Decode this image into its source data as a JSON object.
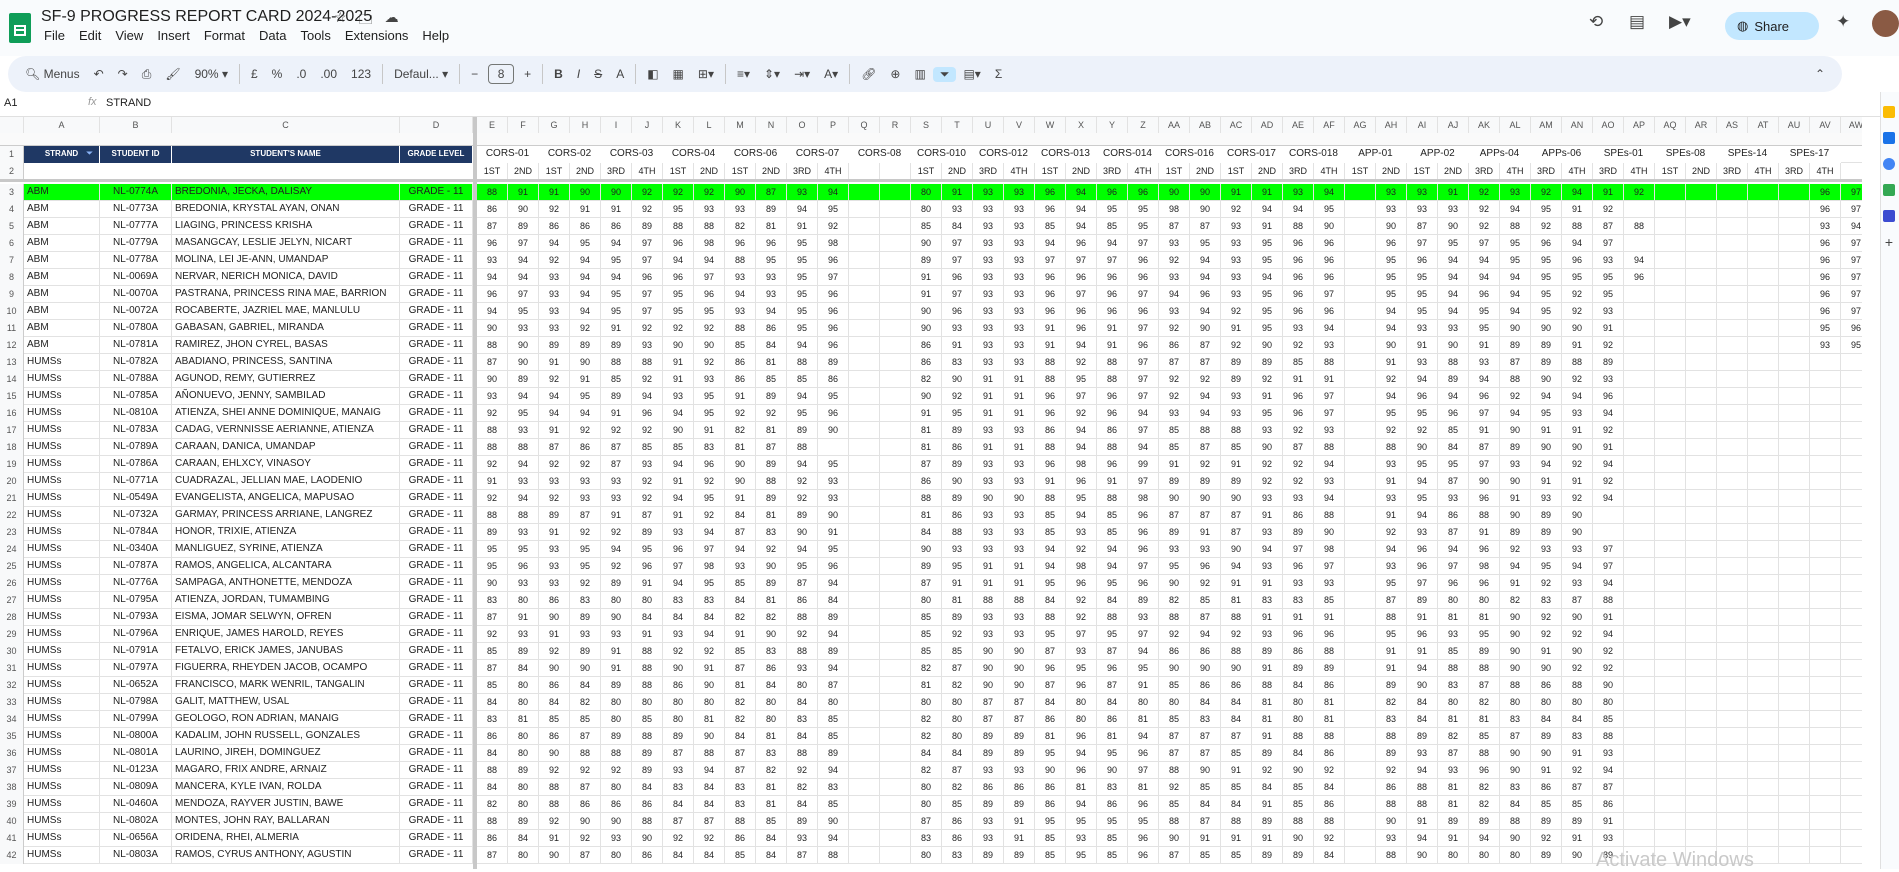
{
  "doc": {
    "title": "SF-9 PROGRESS REPORT CARD 2024-2025",
    "menus": [
      "File",
      "Edit",
      "View",
      "Insert",
      "Format",
      "Data",
      "Tools",
      "Extensions",
      "Help"
    ]
  },
  "toolbar": {
    "menus_label": "Menus",
    "zoom": "90%",
    "currency": "£",
    "percent": "%",
    "dec_less": ".0",
    "dec_more": ".00",
    "number_format": "123",
    "font": "Defaul...",
    "font_size": "8"
  },
  "share": {
    "label": "Share"
  },
  "formula": {
    "cell": "A1",
    "fx": "fx",
    "value": "STRAND"
  },
  "columns": {
    "letters_left": [
      "A",
      "B",
      "C",
      "D"
    ],
    "letters_right": [
      "E",
      "F",
      "G",
      "H",
      "I",
      "J",
      "K",
      "L",
      "M",
      "N",
      "O",
      "P",
      "Q",
      "R",
      "S",
      "T",
      "U",
      "V",
      "W",
      "X",
      "Y",
      "Z",
      "AA",
      "AB",
      "AC",
      "AD",
      "AE",
      "AF",
      "AG",
      "AH",
      "AI",
      "AJ",
      "AK",
      "AL",
      "AM",
      "AN",
      "AO",
      "AP",
      "AQ",
      "AR",
      "AS",
      "AT",
      "AU",
      "AV",
      "AW",
      "AX"
    ]
  },
  "headers_left": [
    "STRAND",
    "STUDENT ID",
    "STUDENT'S NAME",
    "GRADE LEVEL"
  ],
  "subjects": [
    {
      "label": "CORS-01",
      "q": [
        "1ST",
        "2ND"
      ]
    },
    {
      "label": "CORS-02",
      "q": [
        "1ST",
        "2ND"
      ]
    },
    {
      "label": "CORS-03",
      "q": [
        "3RD",
        "4TH"
      ]
    },
    {
      "label": "CORS-04",
      "q": [
        "1ST",
        "2ND"
      ]
    },
    {
      "label": "CORS-06",
      "q": [
        "1ST",
        "2ND"
      ]
    },
    {
      "label": "CORS-07",
      "q": [
        "3RD",
        "4TH"
      ]
    },
    {
      "label": "CORS-08",
      "q": [
        "",
        ""
      ]
    },
    {
      "label": "CORS-010",
      "q": [
        "1ST",
        "2ND"
      ]
    },
    {
      "label": "CORS-012",
      "q": [
        "3RD",
        "4TH"
      ]
    },
    {
      "label": "CORS-013",
      "q": [
        "1ST",
        "2ND"
      ]
    },
    {
      "label": "CORS-014",
      "q": [
        "3RD",
        "4TH"
      ]
    },
    {
      "label": "CORS-016",
      "q": [
        "1ST",
        "2ND"
      ]
    },
    {
      "label": "CORS-017",
      "q": [
        "1ST",
        "2ND"
      ]
    },
    {
      "label": "CORS-018",
      "q": [
        "3RD",
        "4TH"
      ]
    },
    {
      "label": "APP-01",
      "q": [
        "1ST",
        "2ND"
      ]
    },
    {
      "label": "APP-02",
      "q": [
        "1ST",
        "2ND"
      ]
    },
    {
      "label": "APPs-04",
      "q": [
        "3RD",
        "4TH"
      ]
    },
    {
      "label": "APPs-06",
      "q": [
        "3RD",
        "4TH"
      ]
    },
    {
      "label": "SPEs-01",
      "q": [
        "3RD",
        "4TH"
      ]
    },
    {
      "label": "SPEs-08",
      "q": [
        "1ST",
        "2ND"
      ]
    },
    {
      "label": "SPEs-14",
      "q": [
        "3RD",
        "4TH"
      ]
    },
    {
      "label": "SPEs-17",
      "q": [
        "3RD",
        "4TH"
      ]
    }
  ],
  "rows": [
    {
      "n": "3",
      "strand": "ABM",
      "id": "NL-0774A",
      "name": "BREDONIA, JECKA, DALISAY",
      "grade": "GRADE - 11",
      "hl": true,
      "s": "88 91 91 90 90 92 92 92 90 87 93 94 _ _ 80 91 93 93 96 94 96 96 90 90 91 91 93 94 _ 93 93 91 92 93 92 94 91 92 _ _ _ _ _ 96 97 _ _"
    },
    {
      "n": "4",
      "strand": "ABM",
      "id": "NL-0773A",
      "name": "BREDONIA, KRYSTAL AYAN, ONAN",
      "grade": "GRADE - 11",
      "s": "86 90 92 91 91 92 95 93 93 89 94 95 _ _ 80 93 93 93 96 94 95 95 98 90 92 94 94 95 _ 93 93 93 92 94 95 91 92 _ _ _ _ _ _ 96 97 _ _"
    },
    {
      "n": "5",
      "strand": "ABM",
      "id": "NL-0777A",
      "name": "LIAGING, PRINCESS KRISHA",
      "grade": "GRADE - 11",
      "s": "87 89 86 86 86 89 88 88 82 81 91 92 _ _ 85 84 93 93 85 94 85 95 87 87 93 91 88 90 _ 90 87 90 92 88 92 88 87 88 _ _ _ _ _ 93 94 _ _"
    },
    {
      "n": "6",
      "strand": "ABM",
      "id": "NL-0779A",
      "name": "MASANGCAY, LESLIE JELYN, NICART",
      "grade": "GRADE - 11",
      "s": "96 97 94 95 94 97 96 98 96 96 95 98 _ _ 90 97 93 93 94 96 94 97 93 95 93 95 96 96 _ 96 97 95 97 95 96 94 97 _ _ _ _ _ _ 96 97 _ _"
    },
    {
      "n": "7",
      "strand": "ABM",
      "id": "NL-0778A",
      "name": "MOLINA, LEI JE-ANN, UMANDAP",
      "grade": "GRADE - 11",
      "s": "93 94 92 94 95 97 94 94 88 95 95 96 _ _ 89 97 93 93 97 97 97 96 92 94 93 95 96 96 _ 95 96 94 94 95 95 96 93 94 _ _ _ _ _ 96 97 _ _"
    },
    {
      "n": "8",
      "strand": "ABM",
      "id": "NL-0069A",
      "name": "NERVAR, NERICH MONICA, DAVID",
      "grade": "GRADE - 11",
      "s": "94 94 93 94 94 96 96 97 93 93 95 97 _ _ 91 96 93 93 96 96 96 96 93 94 93 94 96 96 _ 95 95 94 94 94 95 95 95 96 _ _ _ _ _ 96 97 _ _"
    },
    {
      "n": "9",
      "strand": "ABM",
      "id": "NL-0070A",
      "name": "PASTRANA, PRINCESS RINA MAE, BARRION",
      "grade": "GRADE - 11",
      "s": "96 97 93 94 95 97 95 96 94 93 95 96 _ _ 91 97 93 93 96 97 96 97 94 96 93 95 96 97 _ 95 95 94 96 94 95 92 95 _ _ _ _ _ _ 96 97 _ _"
    },
    {
      "n": "10",
      "strand": "ABM",
      "id": "NL-0072A",
      "name": "ROCABERTE, JAZRIEL MAE, MANLULU",
      "grade": "GRADE - 11",
      "s": "94 95 93 94 95 97 95 95 93 94 95 96 _ _ 90 96 93 93 96 96 96 96 93 94 92 95 96 96 _ 94 95 94 95 94 95 92 93 _ _ _ _ _ _ 96 97 _ _"
    },
    {
      "n": "11",
      "strand": "ABM",
      "id": "NL-0780A",
      "name": "GABASAN, GABRIEL, MIRANDA",
      "grade": "GRADE - 11",
      "s": "90 93 93 92 91 92 92 92 88 86 95 96 _ _ 90 93 93 93 91 96 91 97 92 90 91 95 93 94 _ 94 93 93 95 90 90 90 91 _ _ _ _ _ _ 95 96 _ _"
    },
    {
      "n": "12",
      "strand": "ABM",
      "id": "NL-0781A",
      "name": "RAMIREZ, JHON CYREL, BASAS",
      "grade": "GRADE - 11",
      "s": "88 90 89 89 89 93 90 90 85 84 94 96 _ _ 86 91 93 93 91 94 91 96 86 87 92 90 92 93 _ 90 91 90 91 89 89 91 92 _ _ _ _ _ _ 93 95 _ _"
    },
    {
      "n": "13",
      "strand": "HUMSs",
      "id": "NL-0782A",
      "name": "ABADIANO, PRINCESS, SANTINA",
      "grade": "GRADE - 11",
      "s": "87 90 91 90 88 88 91 92 86 81 88 89 _ _ 86 83 93 93 88 92 88 97 87 87 89 89 85 88 _ 91 93 88 93 87 89 88 89 _ _ _ _ _ _ _ _ 90 _"
    },
    {
      "n": "14",
      "strand": "HUMSs",
      "id": "NL-0788A",
      "name": "AGUNOD, REMY, GUTIERREZ",
      "grade": "GRADE - 11",
      "s": "90 89 92 91 85 92 91 93 86 85 85 86 _ _ 82 90 91 91 88 95 88 97 92 92 89 92 91 91 _ 92 94 89 94 88 90 92 93 _ _ _ _ _ _ _ _ 91 _"
    },
    {
      "n": "15",
      "strand": "HUMSs",
      "id": "NL-0785A",
      "name": "AÑONUEVO, JENNY, SAMBILAD",
      "grade": "GRADE - 11",
      "s": "93 94 94 95 89 94 93 95 91 89 94 95 _ _ 90 92 91 91 96 97 96 97 92 94 93 91 96 97 _ 94 96 94 96 92 94 94 96 _ _ _ _ _ _ _ _ 93 _"
    },
    {
      "n": "16",
      "strand": "HUMSs",
      "id": "NL-0810A",
      "name": "ATIENZA, SHEI ANNE DOMINIQUE, MANAIG",
      "grade": "GRADE - 11",
      "s": "92 95 94 94 91 96 94 95 92 92 95 96 _ _ 91 95 91 91 96 92 96 94 93 94 93 95 96 97 _ 95 95 96 97 94 95 93 94 _ _ _ _ _ _ _ _ 94 _"
    },
    {
      "n": "17",
      "strand": "HUMSs",
      "id": "NL-0783A",
      "name": "CADAG, VERNNISSE AERIANNE, ATIENZA",
      "grade": "GRADE - 11",
      "s": "88 93 91 92 92 92 90 91 82 81 89 90 _ _ 81 89 93 93 86 94 86 97 85 88 88 93 92 93 _ 92 92 85 91 90 91 91 92 _ _ _ _ _ _ _ _ 95 _"
    },
    {
      "n": "18",
      "strand": "HUMSs",
      "id": "NL-0789A",
      "name": "CARAAN, DANICA, UMANDAP",
      "grade": "GRADE - 11",
      "s": "88 88 87 86 87 85 85 83 81 87 88 _ _ _ 81 86 91 91 88 94 88 94 85 87 85 90 87 88 _ 88 90 84 87 89 90 90 91 _ _ _ _ _ _ _ _ 91 _"
    },
    {
      "n": "19",
      "strand": "HUMSs",
      "id": "NL-0786A",
      "name": "CARAAN, EHLXCY, VINASOY",
      "grade": "GRADE - 11",
      "s": "92 94 92 92 87 93 94 96 90 89 94 95 _ _ 87 89 93 93 96 98 96 99 91 92 91 92 92 94 _ 93 95 95 97 93 94 92 94 _ _ _ _ _ _ _ _ 94 _"
    },
    {
      "n": "20",
      "strand": "HUMSs",
      "id": "NL-0771A",
      "name": "CUADRAZAL, JELLIAN MAE, LAODENIO",
      "grade": "GRADE - 11",
      "s": "91 93 93 93 93 92 91 92 90 88 92 93 _ _ 86 90 93 93 91 96 91 97 89 89 89 92 92 93 _ 91 94 87 90 90 91 91 92 _ _ _ _ _ _ _ _ 96 _"
    },
    {
      "n": "21",
      "strand": "HUMSs",
      "id": "NL-0549A",
      "name": "EVANGELISTA, ANGELICA, MAPUSAO",
      "grade": "GRADE - 11",
      "s": "92 94 92 93 93 92 94 95 91 89 92 93 _ _ 88 89 90 90 88 95 88 98 90 90 90 93 93 94 _ 93 95 93 96 91 93 92 94 _ _ _ _ _ _ _ _ 96 _"
    },
    {
      "n": "22",
      "strand": "HUMSs",
      "id": "NL-0732A",
      "name": "GARMAY, PRINCESS ARRIANE, LANGREZ",
      "grade": "GRADE - 11",
      "s": "88 88 89 87 91 87 91 92 84 81 89 90 _ _ 81 86 93 93 85 94 85 96 87 87 87 91 86 88 _ 91 94 86 88 90 89 90 _ _ _ _ _ _ _ _ _ 91 _"
    },
    {
      "n": "23",
      "strand": "HUMSs",
      "id": "NL-0784A",
      "name": "HONOR, TRIXIE, ATIENZA",
      "grade": "GRADE - 11",
      "s": "89 93 91 92 92 89 93 94 87 83 90 91 _ _ 84 88 93 93 85 93 85 96 89 91 87 93 89 90 _ 92 93 87 91 89 89 90 _ _ _ _ _ _ _ _ _ 90 _"
    },
    {
      "n": "24",
      "strand": "HUMSs",
      "id": "NL-0340A",
      "name": "MANLIGUEZ, SYRINE, ATIENZA",
      "grade": "GRADE - 11",
      "s": "95 95 93 95 94 95 96 97 94 92 94 95 _ _ 90 93 93 93 94 92 94 96 93 93 90 94 97 98 _ 94 96 94 96 92 93 93 97 _ _ _ _ _ _ _ _ 94 _"
    },
    {
      "n": "25",
      "strand": "HUMSs",
      "id": "NL-0787A",
      "name": "RAMOS, ANGELICA, ALCANTARA",
      "grade": "GRADE - 11",
      "s": "95 96 93 95 92 96 97 98 93 90 95 96 _ _ 89 95 91 91 94 98 94 97 95 96 94 93 96 97 _ 93 96 97 98 94 95 94 97 _ _ _ _ _ _ _ _ 95 _"
    },
    {
      "n": "26",
      "strand": "HUMSs",
      "id": "NL-0776A",
      "name": "SAMPAGA, ANTHONETTE, MENDOZA",
      "grade": "GRADE - 11",
      "s": "90 93 93 92 89 91 94 95 85 89 87 94 _ _ 87 91 91 91 95 96 95 96 90 92 91 91 93 93 _ 95 97 96 96 91 92 93 94 _ _ _ _ _ _ _ _ 95 _"
    },
    {
      "n": "27",
      "strand": "HUMSs",
      "id": "NL-0795A",
      "name": "ATIENZA, JORDAN, TUMAMBING",
      "grade": "GRADE - 11",
      "s": "83 80 86 83 80 80 83 83 84 81 86 84 _ _ 80 81 88 88 84 92 84 89 82 85 81 83 83 85 _ 87 89 80 80 82 83 87 88 _ _ _ _ _ _ _ _ 86 _"
    },
    {
      "n": "28",
      "strand": "HUMSs",
      "id": "NL-0793A",
      "name": "EISMA, JOMAR SELWYN, OFREN",
      "grade": "GRADE - 11",
      "s": "87 91 90 89 90 84 84 84 82 82 88 89 _ _ 85 89 93 93 88 92 88 93 88 87 88 91 91 91 _ 88 91 81 81 90 92 90 91 _ _ _ _ _ _ _ _ 92 _"
    },
    {
      "n": "29",
      "strand": "HUMSs",
      "id": "NL-0796A",
      "name": "ENRIQUE, JAMES HAROLD, REYES",
      "grade": "GRADE - 11",
      "s": "92 93 91 93 93 91 93 94 91 90 92 94 _ _ 85 92 93 93 95 97 95 97 92 94 92 93 96 96 _ 95 96 93 95 90 92 92 94 _ _ _ _ _ _ _ _ 94 _"
    },
    {
      "n": "30",
      "strand": "HUMSs",
      "id": "NL-0791A",
      "name": "FETALVO, ERICK JAMES, JANUBAS",
      "grade": "GRADE - 11",
      "s": "85 89 92 89 91 88 92 92 85 83 88 89 _ _ 85 85 90 90 87 93 87 94 86 86 88 89 86 88 _ 91 91 85 89 90 91 90 92 _ _ _ _ _ _ _ _ 89 _"
    },
    {
      "n": "31",
      "strand": "HUMSs",
      "id": "NL-0797A",
      "name": "FIGUERRA, RHEYDEN JACOB, OCAMPO",
      "grade": "GRADE - 11",
      "s": "87 84 90 90 91 88 90 91 87 86 93 94 _ _ 82 87 90 90 96 95 96 95 90 90 90 91 89 89 _ 91 94 88 88 90 90 92 92 _ _ _ _ _ _ _ _ 92 _"
    },
    {
      "n": "32",
      "strand": "HUMSs",
      "id": "NL-0652A",
      "name": "FRANCISCO, MARK WENRIL, TANGALIN",
      "grade": "GRADE - 11",
      "s": "85 80 86 84 89 88 86 90 81 84 80 87 _ _ 81 82 90 90 87 96 87 91 85 86 86 88 84 86 _ 89 90 83 87 88 86 88 90 _ _ _ _ _ _ _ _ 89 _"
    },
    {
      "n": "33",
      "strand": "HUMSs",
      "id": "NL-0798A",
      "name": "GALIT, MATTHEW, USAL",
      "grade": "GRADE - 11",
      "s": "84 80 84 82 80 80 80 80 82 80 84 80 _ _ 80 80 87 87 84 80 84 80 80 84 84 81 80 81 _ 82 84 80 82 80 80 80 80 _ _ _ _ _ _ _ _ 84 _"
    },
    {
      "n": "34",
      "strand": "HUMSs",
      "id": "NL-0799A",
      "name": "GEOLOGO, RON ADRIAN, MANAIG",
      "grade": "GRADE - 11",
      "s": "83 81 85 85 80 85 80 81 82 80 83 85 _ _ 82 80 87 87 86 80 86 81 85 83 84 81 80 81 _ 83 84 81 81 83 84 84 85 _ _ _ _ _ _ _ _ 86 _"
    },
    {
      "n": "35",
      "strand": "HUMSs",
      "id": "NL-0800A",
      "name": "KADALIM, JOHN RUSSELL, GONZALES",
      "grade": "GRADE - 11",
      "s": "86 80 86 87 89 88 89 90 84 81 84 85 _ _ 82 80 89 89 81 96 81 94 87 87 87 91 88 88 _ 88 89 82 85 87 89 83 88 _ _ _ _ _ _ _ _ 88 _"
    },
    {
      "n": "36",
      "strand": "HUMSs",
      "id": "NL-0801A",
      "name": "LAURINO, JIREH, DOMINGUEZ",
      "grade": "GRADE - 11",
      "s": "84 80 90 88 88 89 87 88 87 83 88 89 _ _ 84 84 89 89 95 94 95 96 87 87 85 89 84 86 _ 89 93 87 88 90 90 91 93 _ _ _ _ _ _ _ _ 93 _"
    },
    {
      "n": "37",
      "strand": "HUMSs",
      "id": "NL-0123A",
      "name": "MAGARO, FRIX ANDRE, ARNAIZ",
      "grade": "GRADE - 11",
      "s": "88 89 92 92 92 89 93 94 87 82 92 94 _ _ 82 87 93 93 90 96 90 97 88 90 91 92 90 92 _ 92 94 93 96 90 91 92 94 _ _ _ _ _ _ _ _ 93 _"
    },
    {
      "n": "38",
      "strand": "HUMSs",
      "id": "NL-0809A",
      "name": "MANCERA, KYLE IVAN, ROLDA",
      "grade": "GRADE - 11",
      "s": "84 80 88 87 80 84 83 84 83 81 82 83 _ _ 80 82 86 86 86 81 83 81 92 85 85 84 85 84 _ 86 88 81 82 83 86 87 87 _ _ _ _ _ _ _ _ 86 _"
    },
    {
      "n": "39",
      "strand": "HUMSs",
      "id": "NL-0460A",
      "name": "MENDOZA, RAYVER JUSTIN, BAWE",
      "grade": "GRADE - 11",
      "s": "82 80 88 86 86 86 84 84 83 81 84 85 _ _ 80 85 89 89 86 94 86 96 85 84 84 91 85 86 _ 88 88 81 82 84 85 85 86 _ _ _ _ _ _ _ _ 81 _"
    },
    {
      "n": "40",
      "strand": "HUMSs",
      "id": "NL-0802A",
      "name": "MONTES, JOHN RAY, BALLARAN",
      "grade": "GRADE - 11",
      "s": "88 89 92 90 90 88 87 87 88 85 89 90 _ _ 87 86 93 91 95 95 95 95 88 87 88 89 88 88 _ 90 91 89 89 88 89 89 91 _ _ _ _ _ _ _ _ 91 _"
    },
    {
      "n": "41",
      "strand": "HUMSs",
      "id": "NL-0656A",
      "name": "ORIDENA, RHEI, ALMERIA",
      "grade": "GRADE - 11",
      "s": "86 84 91 92 93 90 92 92 86 84 93 94 _ _ 83 86 93 91 85 93 85 96 90 91 91 91 90 92 _ 93 94 91 94 90 92 91 93 _ _ _ _ _ _ _ _ 90 _"
    },
    {
      "n": "42",
      "strand": "HUMSs",
      "id": "NL-0803A",
      "name": "RAMOS, CYRUS ANTHONY, AGUSTIN",
      "grade": "GRADE - 11",
      "s": "87 80 90 87 80 86 84 84 85 84 87 88 _ _ 80 83 89 89 85 95 85 96 87 85 85 89 89 84 _ 88 90 80 80 80 89 90 89 _ _ _ _ _ _ _ _ 88 _"
    }
  ],
  "watermark": "Activate Windows",
  "colors": {
    "header_bg": "#1f3864",
    "highlight": "#00ff00",
    "share": "#c2e7ff"
  }
}
